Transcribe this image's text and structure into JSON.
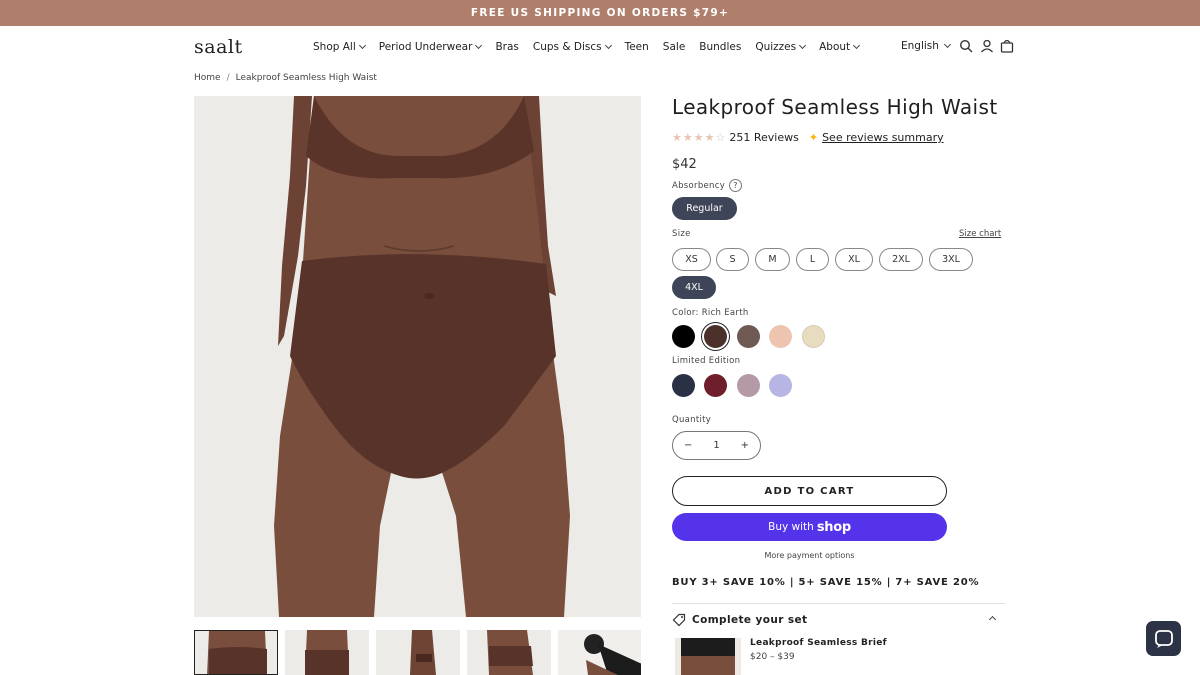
{
  "announcement": "FREE US SHIPPING ON ORDERS $79+",
  "header": {
    "logo": "saalt",
    "nav": [
      {
        "label": "Shop All",
        "dropdown": true
      },
      {
        "label": "Period Underwear",
        "dropdown": true
      },
      {
        "label": "Bras",
        "dropdown": false
      },
      {
        "label": "Cups & Discs",
        "dropdown": true
      },
      {
        "label": "Teen",
        "dropdown": false
      },
      {
        "label": "Sale",
        "dropdown": false
      },
      {
        "label": "Bundles",
        "dropdown": false
      },
      {
        "label": "Quizzes",
        "dropdown": true
      },
      {
        "label": "About",
        "dropdown": true
      }
    ],
    "language": "English",
    "icons": [
      "search-icon",
      "account-icon",
      "cart-icon"
    ]
  },
  "breadcrumb": {
    "home": "Home",
    "separator": "/",
    "current": "Leakproof Seamless High Waist"
  },
  "product": {
    "title": "Leakproof Seamless High Waist",
    "rating": 4,
    "reviews_count": "251 Reviews",
    "reviews_summary_link": "See reviews summary",
    "price": "$42",
    "absorbency_label": "Absorbency",
    "absorbency_help": "?",
    "absorbency_options": [
      {
        "label": "Regular",
        "selected": true
      }
    ],
    "size_label": "Size",
    "size_chart": "Size chart",
    "sizes": [
      {
        "label": "XS",
        "selected": false
      },
      {
        "label": "S",
        "selected": false
      },
      {
        "label": "M",
        "selected": false
      },
      {
        "label": "L",
        "selected": false
      },
      {
        "label": "XL",
        "selected": false
      },
      {
        "label": "2XL",
        "selected": false
      },
      {
        "label": "3XL",
        "selected": false
      },
      {
        "label": "4XL",
        "selected": true
      }
    ],
    "color_label": "Color: Rich Earth",
    "colors": [
      {
        "name": "black",
        "hex": "#000000",
        "selected": false
      },
      {
        "name": "rich-earth",
        "hex": "#4a3029",
        "selected": true
      },
      {
        "name": "taupe",
        "hex": "#6e5a53",
        "selected": false
      },
      {
        "name": "blush",
        "hex": "#ecc4b0",
        "selected": false
      },
      {
        "name": "sand",
        "hex": "#e8dcc0",
        "selected": false
      }
    ],
    "limited_label": "Limited Edition",
    "limited_colors": [
      {
        "name": "navy",
        "hex": "#2b3144"
      },
      {
        "name": "burgundy",
        "hex": "#6e1f2b"
      },
      {
        "name": "mauve",
        "hex": "#b39aa6"
      },
      {
        "name": "lavender",
        "hex": "#b7b5e3"
      }
    ],
    "quantity_label": "Quantity",
    "quantity": "1",
    "qty_minus": "−",
    "qty_plus": "+",
    "add_to_cart": "ADD TO CART",
    "buy_with": "Buy with",
    "shop_brand": "shop",
    "more_payment": "More payment options",
    "promo": "BUY 3+ SAVE 10% | 5+ SAVE 15% | 7+ SAVE 20%",
    "complete_set": "Complete your set",
    "recommendation": {
      "name": "Leakproof Seamless Brief",
      "price": "$20 – $39"
    }
  },
  "accent_colors": {
    "announcement": "#b07f6b",
    "selected_pill": "#3f4558",
    "shop_pay": "#5433eb"
  }
}
